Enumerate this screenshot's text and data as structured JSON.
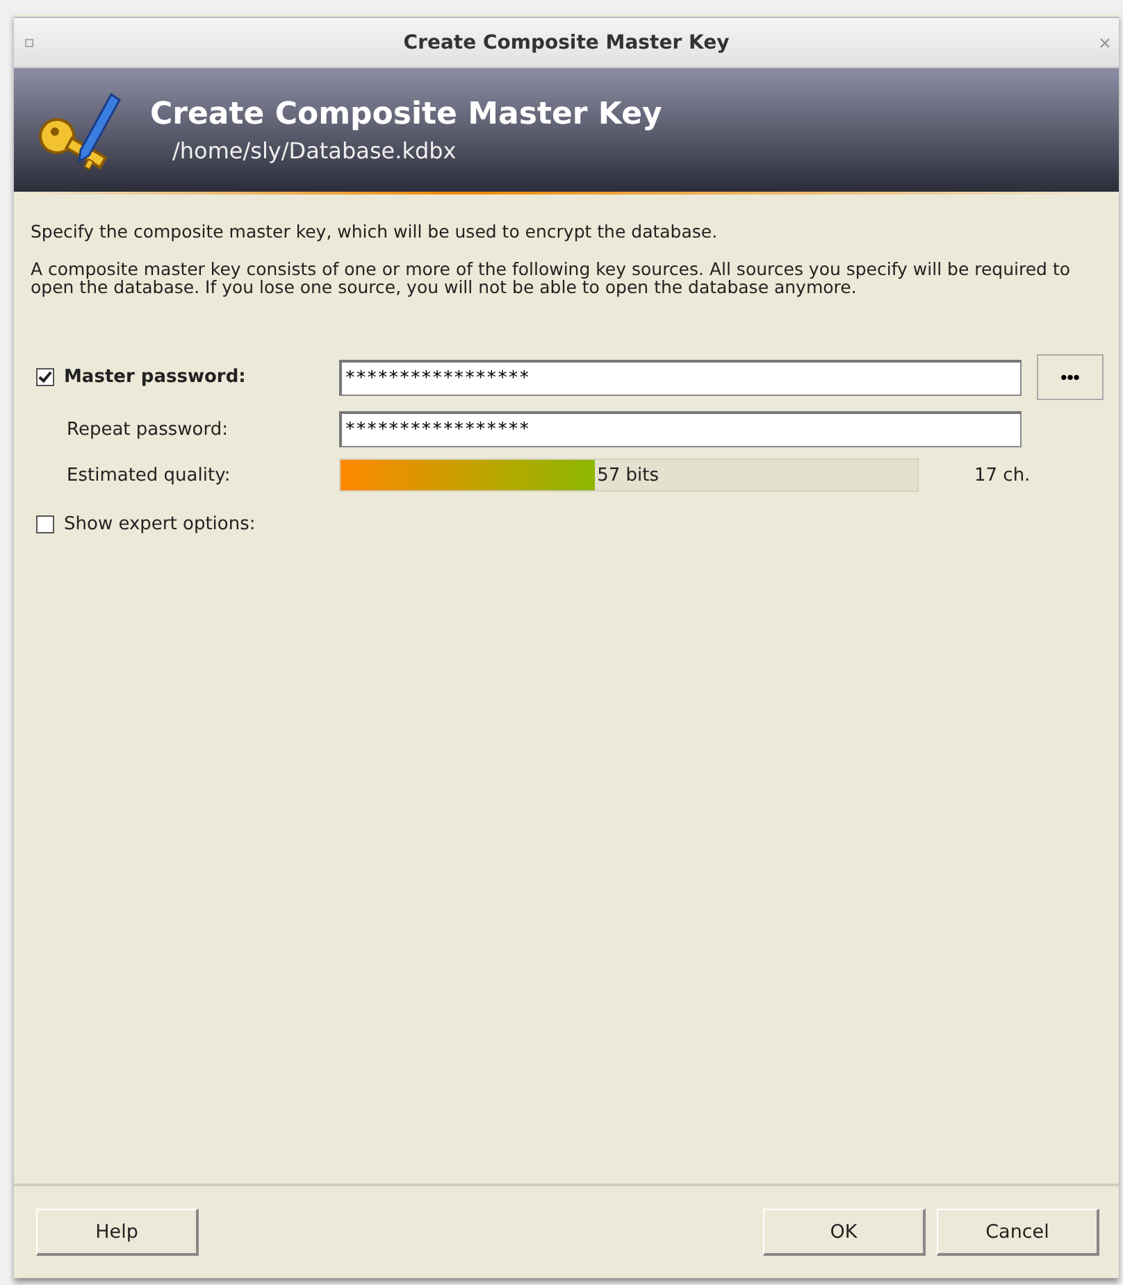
{
  "window": {
    "title": "Create Composite Master Key"
  },
  "banner": {
    "title": "Create Composite Master Key",
    "subtitle": "/home/sly/Database.kdbx"
  },
  "intro": [
    "Specify the composite master key, which will be used to encrypt the database.",
    "A composite master key consists of one or more of the following key sources. All sources you specify will be required to open the database. If you lose one source, you will not be able to open the database anymore."
  ],
  "master_password": {
    "label": "Master password:",
    "checked": true,
    "value": "*****************",
    "reveal_button": "•••"
  },
  "repeat_password": {
    "label": "Repeat password:",
    "value": "*****************"
  },
  "quality": {
    "label": "Estimated quality:",
    "level": 0.44,
    "reading": "57 bits",
    "length": "17 ch."
  },
  "expert_options": {
    "label": "Show expert options:",
    "checked": false
  },
  "buttons": {
    "help": "Help",
    "ok": "OK",
    "cancel": "Cancel"
  }
}
